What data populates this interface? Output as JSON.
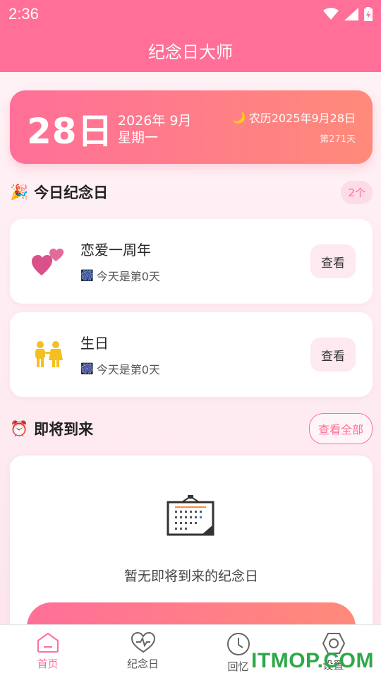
{
  "status_bar": {
    "time": "2:36",
    "icons": [
      "wifi-icon",
      "signal-icon",
      "battery-icon"
    ]
  },
  "app": {
    "title": "纪念日大师"
  },
  "date_card": {
    "day": "28日",
    "year_month": "2026年 9月",
    "weekday": "星期一",
    "lunar_icon": "moon-icon",
    "lunar": "农历2025年9月28日",
    "day_of_year": "第271天"
  },
  "today_section": {
    "icon": "party-popper-icon",
    "title": "今日纪念日",
    "count": "2个",
    "items": [
      {
        "icon": "two-hearts-icon",
        "title": "恋爱一周年",
        "sub_icon": "fireworks-icon",
        "subtitle": "今天是第0天",
        "button": "查看"
      },
      {
        "icon": "couple-icon",
        "title": "生日",
        "sub_icon": "fireworks-icon",
        "subtitle": "今天是第0天",
        "button": "查看"
      }
    ]
  },
  "upcoming_section": {
    "icon": "alarm-clock-icon",
    "title": "即将到来",
    "view_all": "查看全部",
    "empty_icon": "calendar-icon",
    "empty_text": "暂无即将到来的纪念日"
  },
  "tab_bar": {
    "active": "首页",
    "tabs": [
      {
        "label": "首页",
        "icon": "home-icon"
      },
      {
        "label": "纪念日",
        "icon": "heart-icon"
      },
      {
        "label": "回忆",
        "icon": "clock-icon"
      },
      {
        "label": "设置",
        "icon": "settings-icon"
      }
    ]
  },
  "watermark": "ITMOP.COM",
  "colors": {
    "primary": "#ff6f98",
    "accent_end": "#ff8a7a",
    "background": "#fdeef3",
    "watermark": "#2ea84a"
  }
}
